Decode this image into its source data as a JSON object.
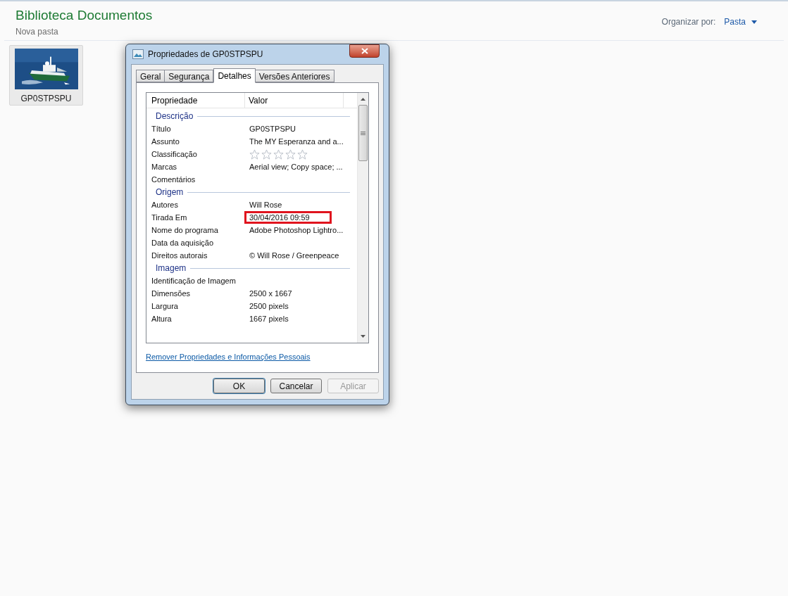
{
  "header": {
    "title": "Biblioteca Documentos",
    "subtitle": "Nova pasta",
    "arrange_label": "Organizar por:",
    "arrange_value": "Pasta"
  },
  "files": [
    {
      "name": "GP0STPSPU",
      "kind": "picture"
    }
  ],
  "dialog": {
    "title": "Propriedades de GP0STPSPU",
    "tabs": [
      {
        "label": "Geral",
        "selected": false
      },
      {
        "label": "Segurança",
        "selected": false
      },
      {
        "label": "Detalhes",
        "selected": true
      },
      {
        "label": "Versões Anteriores",
        "selected": false
      }
    ],
    "columns": [
      "Propriedade",
      "Valor"
    ],
    "rows": [
      {
        "kind": "section",
        "label": "Descrição"
      },
      {
        "kind": "property",
        "label": "Título",
        "value": "GP0STPSPU",
        "highlighted": false
      },
      {
        "kind": "property",
        "label": "Assunto",
        "value": "The MY Esperanza and a...",
        "highlighted": false
      },
      {
        "kind": "rating",
        "label": "Classificação",
        "stars": 0,
        "highlighted": false
      },
      {
        "kind": "property",
        "label": "Marcas",
        "value": "Aerial view; Copy space; ...",
        "highlighted": false
      },
      {
        "kind": "property",
        "label": "Comentários",
        "highlighted": false
      },
      {
        "kind": "section",
        "label": "Origem"
      },
      {
        "kind": "property",
        "label": "Autores",
        "value": "Will Rose",
        "highlighted": false
      },
      {
        "kind": "property",
        "label": "Tirada Em",
        "value": "30/04/2016 09:59",
        "highlighted": true
      },
      {
        "kind": "property",
        "label": "Nome do programa",
        "value": "Adobe Photoshop Lightro...",
        "highlighted": false
      },
      {
        "kind": "property",
        "label": "Data da aquisição",
        "highlighted": false
      },
      {
        "kind": "property",
        "label": "Direitos autorais",
        "value": "© Will Rose / Greenpeace",
        "highlighted": false
      },
      {
        "kind": "section",
        "label": "Imagem"
      },
      {
        "kind": "property",
        "label": "Identificação de Imagem",
        "highlighted": false
      },
      {
        "kind": "property",
        "label": "Dimensões",
        "value": "2500 x 1667",
        "highlighted": false
      },
      {
        "kind": "property",
        "label": "Largura",
        "value": "2500 pixels",
        "highlighted": false
      },
      {
        "kind": "property",
        "label": "Altura",
        "value": "1667 pixels",
        "highlighted": false
      }
    ],
    "link": "Remover Propriedades e Informações Pessoais",
    "buttons": [
      {
        "label": "OK",
        "disabled": false,
        "default": true
      },
      {
        "label": "Cancelar",
        "disabled": false,
        "default": false
      },
      {
        "label": "Aplicar",
        "disabled": true,
        "default": false
      }
    ]
  }
}
